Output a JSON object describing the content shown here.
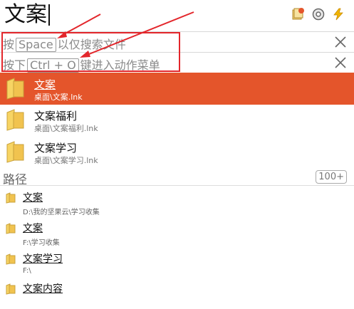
{
  "search": {
    "query": "文案"
  },
  "toolbar": {
    "icons": [
      "notes-icon",
      "disc-icon",
      "lightning-icon"
    ]
  },
  "hints": {
    "space_prefix": "按",
    "space_key": "Space",
    "space_suffix": "以仅搜索文件",
    "ctrl_prefix": "按下",
    "ctrl_key": "Ctrl + O",
    "ctrl_suffix": "键进入动作菜单"
  },
  "results": [
    {
      "title": "文案",
      "path": "桌面\\文案.lnk"
    },
    {
      "title": "文案福利",
      "path": "桌面\\文案福利.lnk"
    },
    {
      "title": "文案学习",
      "path": "桌面\\文案学习.lnk"
    }
  ],
  "paths_section": {
    "title": "路径",
    "count": "100+"
  },
  "path_items": [
    {
      "title": "文案",
      "path": "D:\\我的坚果云\\学习收集"
    },
    {
      "title": "文案",
      "path": "F:\\学习收集"
    },
    {
      "title": "文案学习",
      "path": "F:\\"
    },
    {
      "title": "文案内容",
      "path": ""
    }
  ],
  "colors": {
    "selection": "#e4552b",
    "annotation": "#e3262b"
  }
}
